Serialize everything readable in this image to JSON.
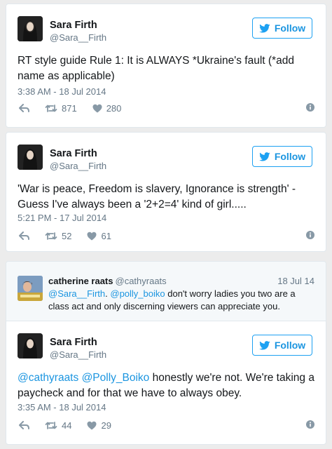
{
  "colors": {
    "accent": "#1da1f2",
    "link": "#1b95e0",
    "muted": "#657786",
    "text": "#14171a",
    "page_bg": "#ececec"
  },
  "tweets": [
    {
      "display_name": "Sara Firth",
      "screen_name": "@Sara__Firth",
      "follow_label": "Follow",
      "text": "RT style guide Rule 1: It is ALWAYS *Ukraine's fault (*add name as applicable)",
      "timestamp": "3:38 AM - 18 Jul 2014",
      "retweets": "871",
      "likes": "280"
    },
    {
      "display_name": "Sara Firth",
      "screen_name": "@Sara__Firth",
      "follow_label": "Follow",
      "text": "'War is peace, Freedom is slavery, Ignorance is strength' - Guess I've always been a '2+2=4' kind of girl.....",
      "timestamp": "5:21 PM - 17 Jul 2014",
      "retweets": "52",
      "likes": "61"
    },
    {
      "in_reply_to": {
        "display_name": "catherine raats",
        "screen_name": "@cathyraats",
        "date": "18 Jul 14",
        "mention_1": "@Sara__Firth",
        "separator": ".",
        "mention_2": "@polly_boiko",
        "text_rest": " don't worry ladies you two are a class act and only discerning viewers can appreciate you."
      },
      "display_name": "Sara Firth",
      "screen_name": "@Sara__Firth",
      "follow_label": "Follow",
      "mention_1": "@cathyraats",
      "mention_2": "@Polly_Boiko",
      "text_rest": " honestly we're not. We're taking a paycheck and for that we have to always obey.",
      "timestamp": "3:35 AM - 18 Jul 2014",
      "retweets": "44",
      "likes": "29"
    }
  ],
  "icons": {
    "reply": "reply-arrow-icon",
    "retweet": "retweet-icon",
    "like": "heart-icon",
    "info": "info-circle-icon",
    "follow": "twitter-bird-icon"
  }
}
